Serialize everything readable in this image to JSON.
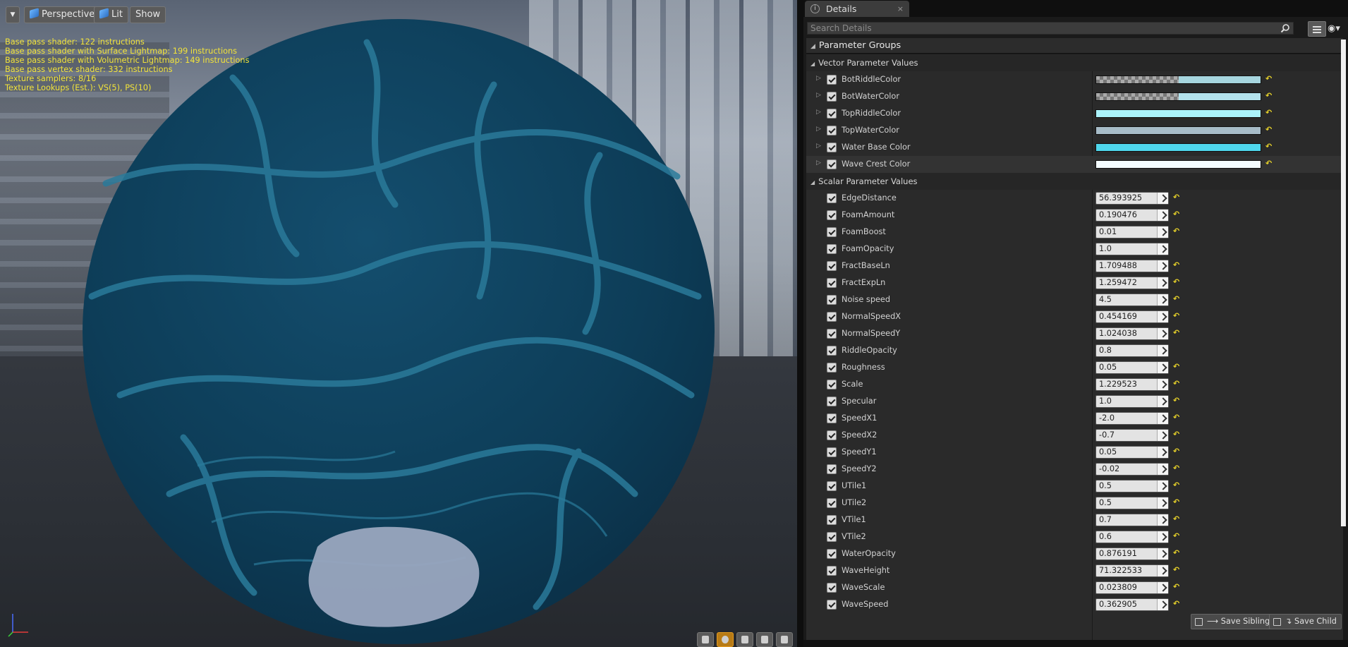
{
  "viewport": {
    "menu_glyph": "▼",
    "perspective_label": "Perspective",
    "lit_label": "Lit",
    "show_label": "Show",
    "stats": [
      "Base pass shader: 122 instructions",
      "Base pass shader with Surface Lightmap: 199 instructions",
      "Base pass shader with Volumetric Lightmap: 149 instructions",
      "Base pass vertex shader: 332 instructions",
      "Texture samplers: 8/16",
      "Texture Lookups (Est.): VS(5), PS(10)"
    ],
    "bottom_icons": [
      "cylinder-icon",
      "sphere-icon",
      "plane-icon",
      "cube-icon",
      "custom-mesh-icon"
    ],
    "active_bottom_icon": "sphere-icon"
  },
  "details": {
    "tab_label": "Details",
    "tab_close": "×",
    "search_placeholder": "Search Details",
    "eye_glyph": "◉▾",
    "parameter_groups_label": "Parameter Groups",
    "vector_section_label": "Vector Parameter Values",
    "scalar_section_label": "Scalar Parameter Values",
    "vector_params": [
      {
        "name": "BotRiddleColor",
        "color": "#a7d6df",
        "alpha": true
      },
      {
        "name": "BotWaterColor",
        "color": "#b4e2ec",
        "alpha": true
      },
      {
        "name": "TopRiddleColor",
        "color": "#abf3fb",
        "alpha": false
      },
      {
        "name": "TopWaterColor",
        "color": "#a7bcc8",
        "alpha": false
      },
      {
        "name": "Water Base Color",
        "color": "#4fd7ec",
        "alpha": false
      },
      {
        "name": "Wave Crest Color",
        "color": "#f4fcff",
        "alpha": false
      }
    ],
    "scalar_params": [
      {
        "name": "EdgeDistance",
        "value": "56.393925",
        "reset": true
      },
      {
        "name": "FoamAmount",
        "value": "0.190476",
        "reset": true
      },
      {
        "name": "FoamBoost",
        "value": "0.01",
        "reset": true
      },
      {
        "name": "FoamOpacity",
        "value": "1.0",
        "reset": false
      },
      {
        "name": "FractBaseLn",
        "value": "1.709488",
        "reset": true
      },
      {
        "name": "FractExpLn",
        "value": "1.259472",
        "reset": true
      },
      {
        "name": "Noise speed",
        "value": "4.5",
        "reset": true
      },
      {
        "name": "NormalSpeedX",
        "value": "0.454169",
        "reset": true
      },
      {
        "name": "NormalSpeedY",
        "value": "1.024038",
        "reset": true
      },
      {
        "name": "RiddleOpacity",
        "value": "0.8",
        "reset": false
      },
      {
        "name": "Roughness",
        "value": "0.05",
        "reset": true
      },
      {
        "name": "Scale",
        "value": "1.229523",
        "reset": true
      },
      {
        "name": "Specular",
        "value": "1.0",
        "reset": true
      },
      {
        "name": "SpeedX1",
        "value": "-2.0",
        "reset": true
      },
      {
        "name": "SpeedX2",
        "value": "-0.7",
        "reset": true
      },
      {
        "name": "SpeedY1",
        "value": "0.05",
        "reset": true
      },
      {
        "name": "SpeedY2",
        "value": "-0.02",
        "reset": true
      },
      {
        "name": "UTile1",
        "value": "0.5",
        "reset": true
      },
      {
        "name": "UTile2",
        "value": "0.5",
        "reset": true
      },
      {
        "name": "VTile1",
        "value": "0.7",
        "reset": true
      },
      {
        "name": "VTile2",
        "value": "0.6",
        "reset": true
      },
      {
        "name": "WaterOpacity",
        "value": "0.876191",
        "reset": true
      },
      {
        "name": "WaveHeight",
        "value": "71.322533",
        "reset": true
      },
      {
        "name": "WaveScale",
        "value": "0.023809",
        "reset": true
      },
      {
        "name": "WaveSpeed",
        "value": "0.362905",
        "reset": true
      }
    ],
    "save_sibling_label": "⟶ Save Sibling",
    "save_child_label": "↴ Save Child",
    "reset_glyph": "↶"
  }
}
